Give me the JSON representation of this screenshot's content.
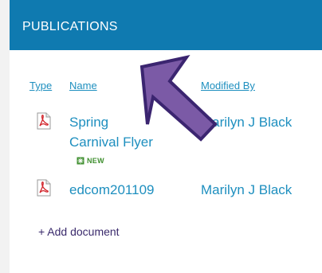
{
  "header": {
    "title": "PUBLICATIONS"
  },
  "columns": {
    "type": "Type",
    "name": "Name",
    "modified_by": "Modified By"
  },
  "documents": [
    {
      "name_line1": "Spring",
      "name_line2": "Carnival Flyer",
      "modified_by": "Marilyn J Black",
      "badge": "NEW",
      "icon": "pdf-icon"
    },
    {
      "name": "edcom201109",
      "modified_by": "Marilyn J Black",
      "icon": "pdf-icon"
    }
  ],
  "add_document": "+ Add document",
  "colors": {
    "header_bg": "#0f7ab0",
    "link": "#1e8fbf",
    "arrow_fill": "#7b5aa6",
    "arrow_stroke": "#3b2570",
    "new_badge": "#3f8f2f"
  }
}
